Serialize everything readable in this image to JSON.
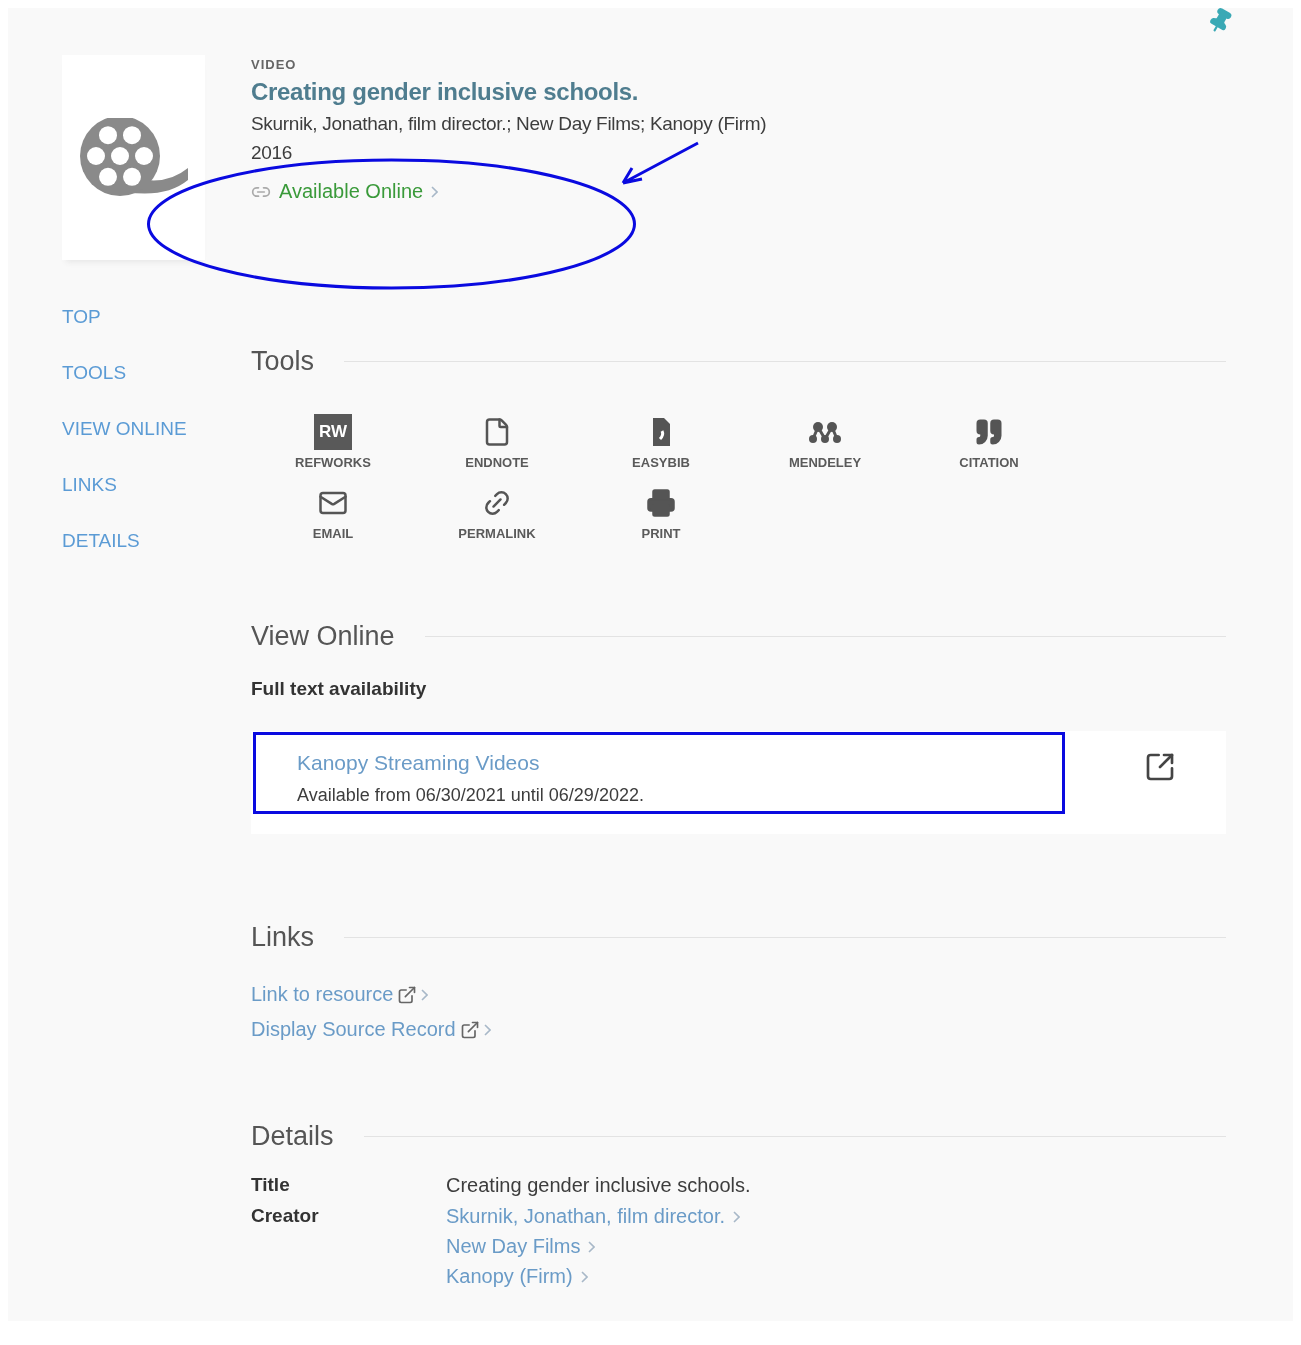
{
  "record": {
    "type": "VIDEO",
    "title": "Creating gender inclusive schools.",
    "authors": "Skurnik, Jonathan, film director.; New Day Films; Kanopy (Firm)",
    "year": "2016",
    "availability": "Available Online"
  },
  "nav": [
    {
      "label": "TOP"
    },
    {
      "label": "TOOLS"
    },
    {
      "label": "VIEW ONLINE"
    },
    {
      "label": "LINKS"
    },
    {
      "label": "DETAILS"
    }
  ],
  "tools": {
    "heading": "Tools",
    "items": [
      {
        "label": "REFWORKS",
        "kind": "refworks",
        "badge": "RW"
      },
      {
        "label": "ENDNOTE",
        "kind": "endnote"
      },
      {
        "label": "EASYBIB",
        "kind": "easybib"
      },
      {
        "label": "MENDELEY",
        "kind": "mendeley"
      },
      {
        "label": "CITATION",
        "kind": "citation"
      },
      {
        "label": "EMAIL",
        "kind": "email"
      },
      {
        "label": "PERMALINK",
        "kind": "permalink"
      },
      {
        "label": "PRINT",
        "kind": "print"
      }
    ]
  },
  "view_online": {
    "heading": "View Online",
    "subheading": "Full text availability",
    "service": {
      "name": "Kanopy Streaming Videos",
      "coverage": "Available from 06/30/2021 until 06/29/2022."
    }
  },
  "links": {
    "heading": "Links",
    "items": [
      {
        "label": "Link to resource"
      },
      {
        "label": "Display Source Record"
      }
    ]
  },
  "details": {
    "heading": "Details",
    "rows": [
      {
        "label": "Title",
        "values": [
          {
            "text": "Creating gender inclusive schools.",
            "link": false
          }
        ]
      },
      {
        "label": "Creator",
        "values": [
          {
            "text": "Skurnik, Jonathan, film director.",
            "link": true
          },
          {
            "text": "New Day Films",
            "link": true
          },
          {
            "text": "Kanopy (Firm)",
            "link": true
          }
        ]
      }
    ]
  }
}
